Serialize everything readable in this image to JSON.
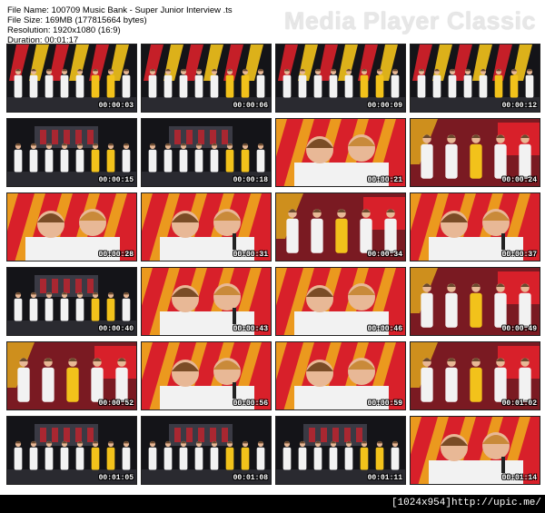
{
  "file_info": {
    "file_name": "File Name: 100709 Music Bank - Super Junior Interview .ts",
    "file_size": "File Size: 169MB (177815664 bytes)",
    "resolution": "Resolution: 1920x1080 (16:9)",
    "duration": "Duration: 00:01:17"
  },
  "brand": "Media Player Classic",
  "thumbnails": [
    {
      "time": "00:00:03",
      "scene": "stage"
    },
    {
      "time": "00:00:06",
      "scene": "stage"
    },
    {
      "time": "00:00:09",
      "scene": "stage"
    },
    {
      "time": "00:00:12",
      "scene": "stage"
    },
    {
      "time": "00:00:15",
      "scene": "stage-dark"
    },
    {
      "time": "00:00:18",
      "scene": "stage-dark"
    },
    {
      "time": "00:00:21",
      "scene": "closeup"
    },
    {
      "time": "00:00:24",
      "scene": "group"
    },
    {
      "time": "00:00:28",
      "scene": "closeup"
    },
    {
      "time": "00:00:31",
      "scene": "closeup"
    },
    {
      "time": "00:00:34",
      "scene": "group"
    },
    {
      "time": "00:00:37",
      "scene": "closeup"
    },
    {
      "time": "00:00:40",
      "scene": "stage-dark"
    },
    {
      "time": "00:00:43",
      "scene": "closeup"
    },
    {
      "time": "00:00:46",
      "scene": "closeup"
    },
    {
      "time": "00:00:49",
      "scene": "group"
    },
    {
      "time": "00:00:52",
      "scene": "group"
    },
    {
      "time": "00:00:56",
      "scene": "closeup"
    },
    {
      "time": "00:00:59",
      "scene": "closeup"
    },
    {
      "time": "00:01:02",
      "scene": "group"
    },
    {
      "time": "00:01:05",
      "scene": "stage-dark"
    },
    {
      "time": "00:01:08",
      "scene": "stage-dark"
    },
    {
      "time": "00:01:11",
      "scene": "stage-dark"
    },
    {
      "time": "00:01:14",
      "scene": "closeup"
    }
  ],
  "footer_text": "[1024x954]http://upic.me/",
  "colors": {
    "stage_red": "#d8202a",
    "stage_yellow": "#f2c21b",
    "dark_bg": "#141418",
    "skin": "#e8b896",
    "shirt": "#f2f2f2"
  }
}
